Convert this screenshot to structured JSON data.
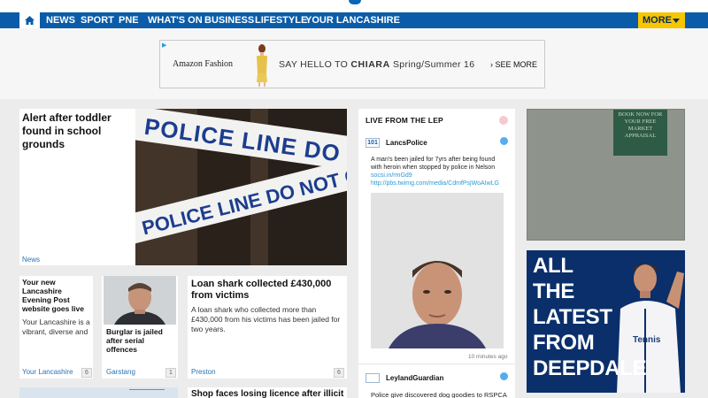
{
  "nav": {
    "items": [
      "NEWS",
      "SPORT",
      "PNE",
      "WHAT'S ON",
      "BUSINESS",
      "LIFESTYLE",
      "YOUR LANCASHIRE"
    ],
    "more_label": "MORE"
  },
  "ad_banner": {
    "brand": "Amazon Fashion",
    "slogan_prefix": "SAY HELLO TO",
    "slogan_name": "CHIARA",
    "slogan_suffix": "Spring/Summer 16",
    "cta": "› SEE MORE"
  },
  "lead_story": {
    "headline": "Alert after toddler found in school grounds",
    "section": "News",
    "tape_text": "POLICE LINE DO NOT CROSS"
  },
  "story_1": {
    "headline": "Your new Lancashire Evening Post website goes live",
    "blurb": "Your Lancashire is a vibrant, diverse and",
    "section": "Your Lancashire",
    "count": "6"
  },
  "story_2": {
    "headline": "Burglar is jailed after serial offences",
    "section": "Garstang",
    "count": "1"
  },
  "story_3": {
    "headline": "Loan shark collected £430,000 from victims",
    "blurb": "A loan shark who collected more than £430,000 from his victims has been jailed for two years.",
    "section": "Preston",
    "count": "6"
  },
  "story_5": {
    "headline": "Shop faces losing licence after illicit"
  },
  "live_blog": {
    "title": "LIVE FROM THE LEP",
    "tweet_1": {
      "avatar": "101",
      "user": "LancsPolice",
      "text": "A man's been jailed for 7yrs after being found with heroin when stopped by police in Nelson",
      "link_1": "socsi.in/rmGd9",
      "link_2": "http://pbs.twimg.com/media/CdmfPsjWoAIwLG",
      "time": "10 minutes ago"
    },
    "tweet_2": {
      "user": "LeylandGuardian",
      "text": "Police give discovered dog goodies to RSPCA"
    }
  },
  "right_ads": {
    "ad1_tag": "BOOK NOW FOR YOUR FREE MARKET APPRAISAL",
    "ad2_words": [
      "ALL",
      "THE",
      "LATEST",
      "FROM",
      "DEEPDALE"
    ],
    "ad2_shirt": "Tennis"
  },
  "colors": {
    "nav_blue": "#0a5ca8",
    "more_yellow": "#f7c600",
    "link_blue": "#2873b8",
    "deepdale_navy": "#0a2f6a"
  }
}
